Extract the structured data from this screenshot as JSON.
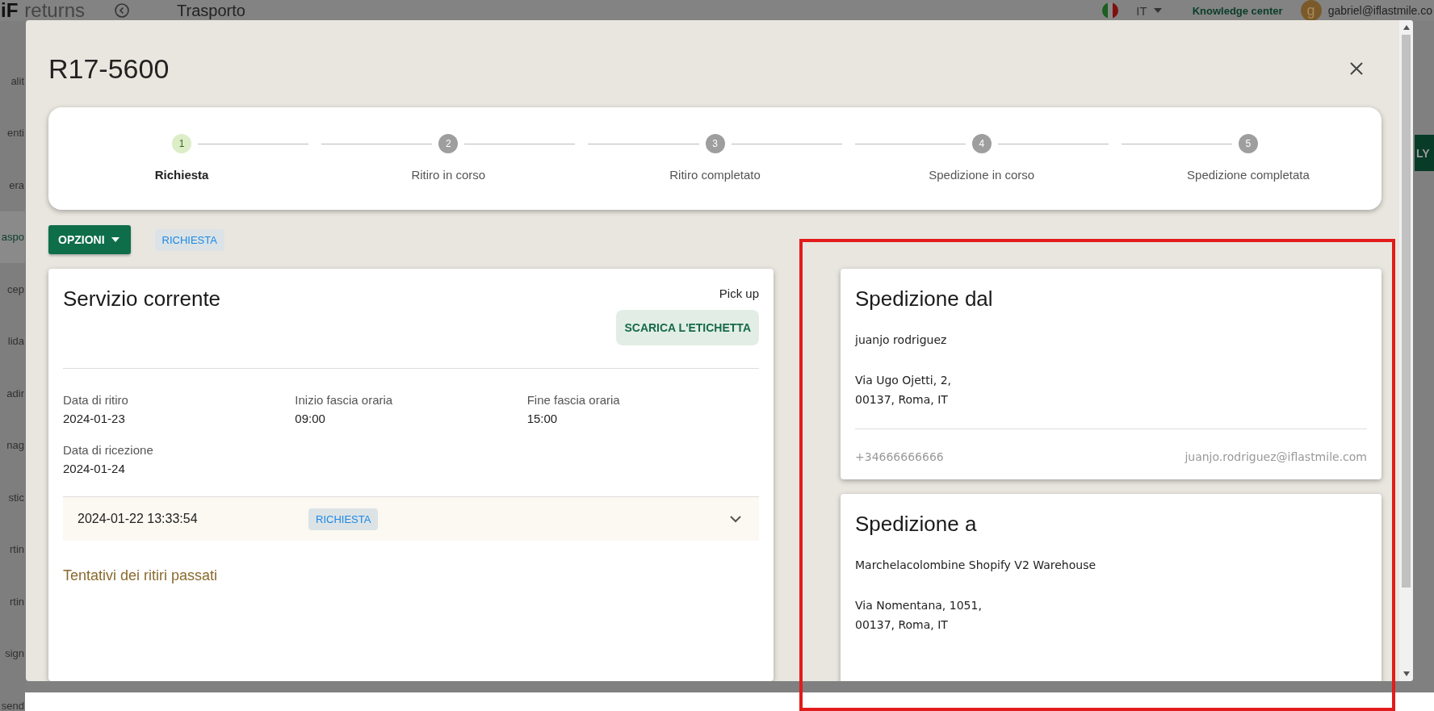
{
  "app_header": {
    "logo": "iF",
    "app_name": "returns",
    "page_title": "Trasporto",
    "language": "IT",
    "help_link": "Knowledge center",
    "avatar_initial": "g",
    "user_email": "gabriel@iflastmile.co"
  },
  "sidebar": {
    "items": [
      {
        "label": "alit",
        "selected": false
      },
      {
        "label": "enti",
        "selected": false
      },
      {
        "label": "era",
        "selected": false
      },
      {
        "label": "aspo",
        "selected": true
      },
      {
        "label": "cep",
        "selected": false
      },
      {
        "label": "lida",
        "selected": false
      },
      {
        "label": "adir",
        "selected": false
      },
      {
        "label": "nag",
        "selected": false
      },
      {
        "label": "stic",
        "selected": false
      },
      {
        "label": "rtin",
        "selected": false
      },
      {
        "label": "rtin",
        "selected": false
      },
      {
        "label": "sign",
        "selected": false
      },
      {
        "label": "send",
        "selected": false
      }
    ]
  },
  "background_button": "LY",
  "modal": {
    "title": "R17-5600",
    "steps": [
      {
        "number": "1",
        "label": "Richiesta",
        "selected": true
      },
      {
        "number": "2",
        "label": "Ritiro in corso",
        "selected": false
      },
      {
        "number": "3",
        "label": "Ritiro completato",
        "selected": false
      },
      {
        "number": "4",
        "label": "Spedizione in corso",
        "selected": false
      },
      {
        "number": "5",
        "label": "Spedizione completata",
        "selected": false
      }
    ],
    "options_button": "OPZIONI",
    "status_chip": "RICHIESTA",
    "service_card": {
      "title": "Servizio corrente",
      "service_type": "Pick up",
      "download_button": "SCARICA L'ETICHETTA",
      "fields": [
        {
          "label": "Data di ritiro",
          "value": "2024-01-23"
        },
        {
          "label": "Inizio fascia oraria",
          "value": "09:00"
        },
        {
          "label": "Fine fascia oraria",
          "value": "15:00"
        },
        {
          "label": "Data di ricezione",
          "value": "2024-01-24"
        }
      ],
      "history_row": {
        "datetime": "2024-01-22 13:33:54",
        "status": "RICHIESTA",
        "expanded": false
      },
      "past_attempts_link": "Tentativi dei ritiri passati"
    },
    "sender_card": {
      "title": "Spedizione dal",
      "name": "juanjo rodriguez",
      "address_lines": [
        "Via Ugo Ojetti, 2,",
        "00137, Roma, IT"
      ],
      "phone": "+34666666666",
      "email": "juanjo.rodriguez@iflastmile.com"
    },
    "recipient_card": {
      "title": "Spedizione a",
      "name": "Marchelacolombine Shopify V2 Warehouse",
      "address_lines": [
        "Via Nomentana, 1051,",
        "00137, Roma, IT"
      ]
    }
  }
}
